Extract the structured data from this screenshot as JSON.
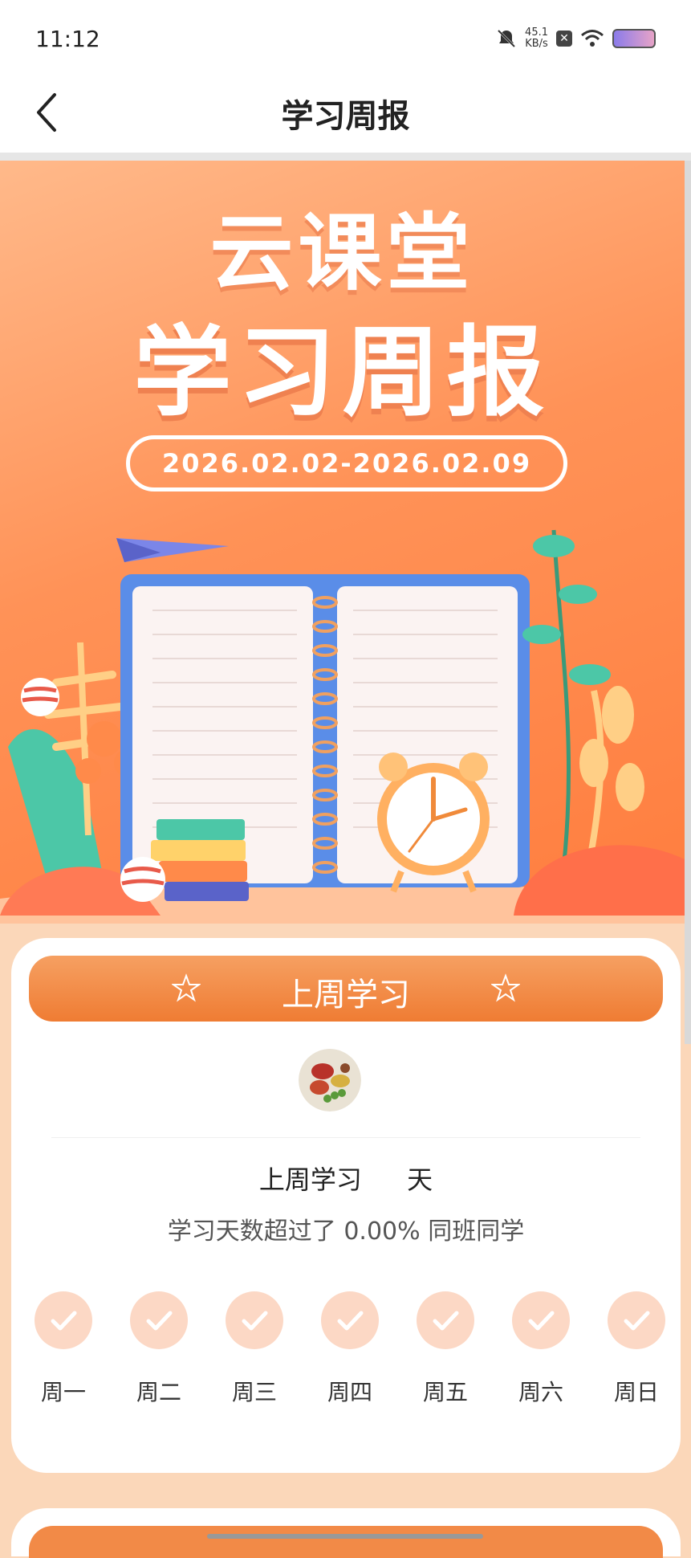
{
  "status_bar": {
    "time": "11:12",
    "net_speed": "45.1",
    "net_unit": "KB/s"
  },
  "nav": {
    "title": "学习周报"
  },
  "banner": {
    "line1": "云课堂",
    "line2": "学习周报",
    "date_range": "2026.02.02-2026.02.09"
  },
  "card": {
    "header": "上周学习",
    "study_days_prefix": "上周学习",
    "study_days_value": "",
    "study_days_unit": "天",
    "compare_prefix": "学习天数超过了",
    "compare_value": "0.00%",
    "compare_suffix": "同班同学",
    "weekdays": [
      "周一",
      "周二",
      "周三",
      "周四",
      "周五",
      "周六",
      "周日"
    ],
    "weekday_checked": [
      true,
      true,
      true,
      true,
      true,
      true,
      true
    ]
  },
  "colors": {
    "accent": "#ef7c33",
    "check_bg": "#fcd8c5",
    "banner": "#ff9257"
  }
}
